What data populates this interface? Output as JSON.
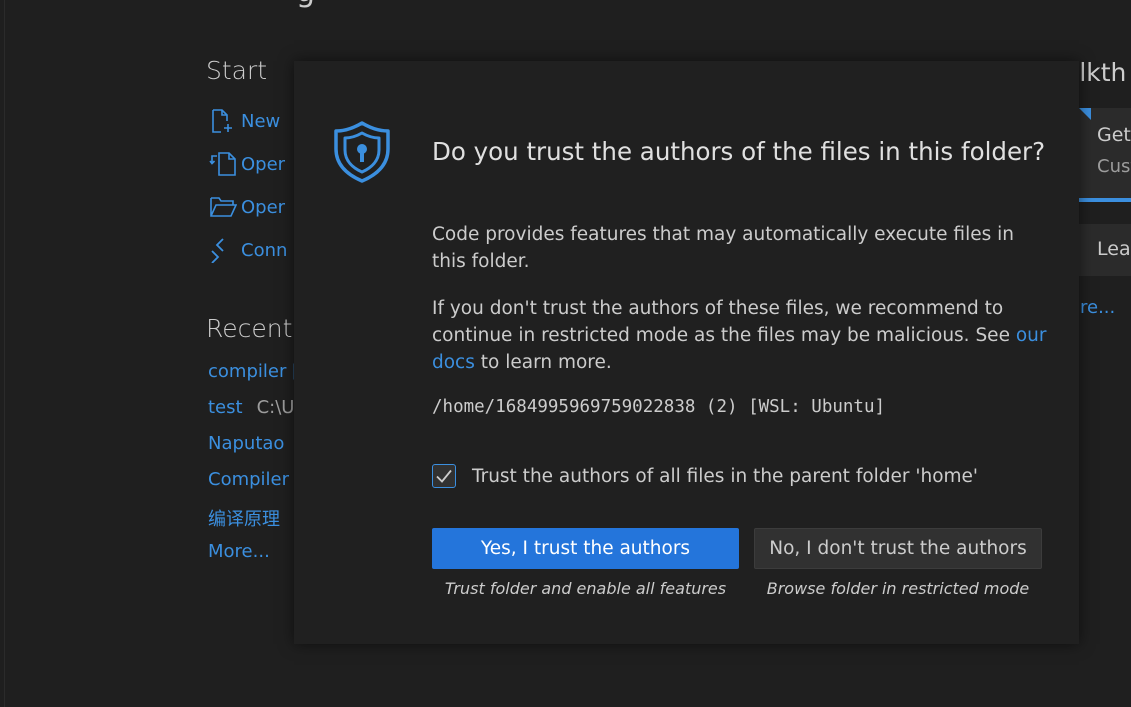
{
  "welcome": {
    "title_partial": "g",
    "start": {
      "heading": "Start",
      "items": [
        {
          "icon": "new-file-icon",
          "label": "New"
        },
        {
          "icon": "open-file-icon",
          "label": "Oper"
        },
        {
          "icon": "open-folder-icon",
          "label": "Oper"
        },
        {
          "icon": "remote-connect-icon",
          "label": "Conn"
        }
      ]
    },
    "recent": {
      "heading": "Recent",
      "items": [
        {
          "name": "compiler [",
          "path": ""
        },
        {
          "name": "test",
          "path": "C:\\U"
        },
        {
          "name": "Naputao",
          "path": ""
        },
        {
          "name": "Compiler",
          "path": ""
        },
        {
          "name": "编译原理",
          "path": ""
        }
      ],
      "more": "More..."
    },
    "walkthroughs": {
      "heading_partial": "alkth",
      "card1_title": "Get",
      "card1_sub": "Cust",
      "card2_title": "Lea",
      "more_partial": "re..."
    }
  },
  "dialog": {
    "icon": "shield-lock-icon",
    "title": "Do you trust the authors of the files in this folder?",
    "paragraph1": "Code provides features that may automatically execute files in this folder.",
    "paragraph2_before": "If you don't trust the authors of these files, we recommend to continue in restricted mode as the files may be malicious. See ",
    "paragraph2_link": "our docs",
    "paragraph2_after": " to learn more.",
    "path": "/home/1684995969759022838 (2) [WSL: Ubuntu]",
    "checkbox": {
      "checked": true,
      "label": "Trust the authors of all files in the parent folder 'home'"
    },
    "yes_button": "Yes, I trust the authors",
    "yes_caption": "Trust folder and enable all features",
    "no_button": "No, I don't trust the authors",
    "no_caption": "Browse folder in restricted mode"
  },
  "colors": {
    "background": "#1f1f1f",
    "dialog_bg": "#202020",
    "accent": "#3b8fdf",
    "primary_button": "#2475db",
    "secondary_button": "#313131"
  }
}
